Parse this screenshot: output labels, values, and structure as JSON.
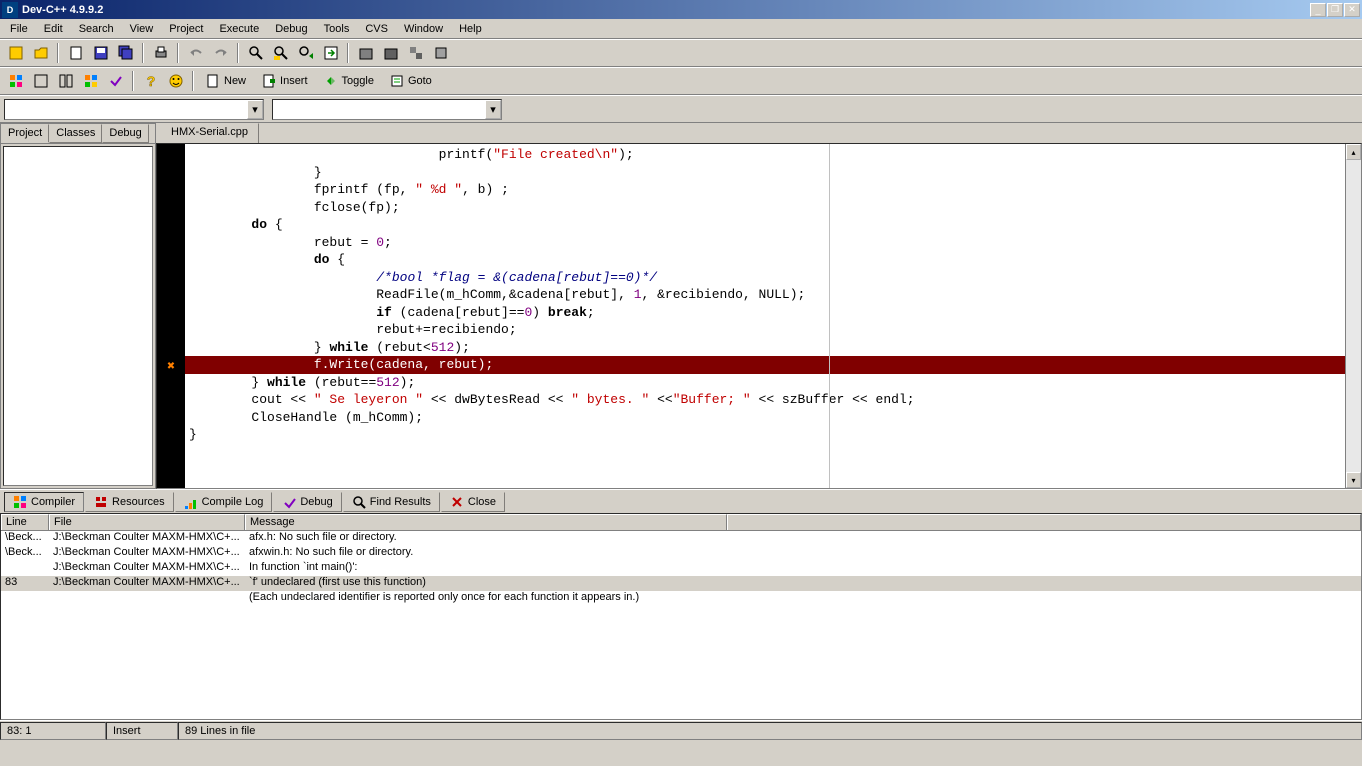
{
  "title": "Dev-C++ 4.9.9.2",
  "menu": [
    "File",
    "Edit",
    "Search",
    "View",
    "Project",
    "Execute",
    "Debug",
    "Tools",
    "CVS",
    "Window",
    "Help"
  ],
  "toolbar2": {
    "new": "New",
    "insert": "Insert",
    "toggle": "Toggle",
    "goto": "Goto"
  },
  "sidebar_tabs": [
    "Project",
    "Classes",
    "Debug"
  ],
  "editor_tab": "HMX-Serial.cpp",
  "code_lines": [
    {
      "indent": 16,
      "parts": [
        {
          "t": "printf(",
          "c": ""
        },
        {
          "t": "\"File created\\n\"",
          "c": "str"
        },
        {
          "t": ");",
          "c": ""
        }
      ]
    },
    {
      "indent": 8,
      "parts": [
        {
          "t": "}",
          "c": ""
        }
      ]
    },
    {
      "indent": 8,
      "parts": [
        {
          "t": "fprintf (fp, ",
          "c": ""
        },
        {
          "t": "\" %d \"",
          "c": "str"
        },
        {
          "t": ", b) ;",
          "c": ""
        }
      ]
    },
    {
      "indent": 8,
      "parts": [
        {
          "t": "fclose(fp);",
          "c": ""
        }
      ]
    },
    {
      "indent": 4,
      "parts": [
        {
          "t": "do",
          "c": "kw"
        },
        {
          "t": " {",
          "c": ""
        }
      ]
    },
    {
      "indent": 8,
      "parts": [
        {
          "t": "rebut = ",
          "c": ""
        },
        {
          "t": "0",
          "c": "num"
        },
        {
          "t": ";",
          "c": ""
        }
      ]
    },
    {
      "indent": 8,
      "parts": [
        {
          "t": "do",
          "c": "kw"
        },
        {
          "t": " {",
          "c": ""
        }
      ]
    },
    {
      "indent": 12,
      "parts": [
        {
          "t": "/*bool *flag = &(cadena[rebut]==0)*/",
          "c": "cmt"
        }
      ]
    },
    {
      "indent": 12,
      "parts": [
        {
          "t": "ReadFile(m_hComm,&cadena[rebut], ",
          "c": ""
        },
        {
          "t": "1",
          "c": "num"
        },
        {
          "t": ", &recibiendo, NULL);",
          "c": ""
        }
      ]
    },
    {
      "indent": 12,
      "parts": [
        {
          "t": "if",
          "c": "kw"
        },
        {
          "t": " (cadena[rebut]==",
          "c": ""
        },
        {
          "t": "0",
          "c": "num"
        },
        {
          "t": ") ",
          "c": ""
        },
        {
          "t": "break",
          "c": "kw"
        },
        {
          "t": ";",
          "c": ""
        }
      ]
    },
    {
      "indent": 12,
      "parts": [
        {
          "t": "rebut+=recibiendo;",
          "c": ""
        }
      ]
    },
    {
      "indent": 8,
      "parts": [
        {
          "t": "} ",
          "c": ""
        },
        {
          "t": "while",
          "c": "kw"
        },
        {
          "t": " (rebut<",
          "c": ""
        },
        {
          "t": "512",
          "c": "num"
        },
        {
          "t": ");",
          "c": ""
        }
      ]
    },
    {
      "indent": 8,
      "hl": true,
      "parts": [
        {
          "t": "f.Write(cadena, rebut);",
          "c": ""
        }
      ]
    },
    {
      "indent": 4,
      "parts": [
        {
          "t": "} ",
          "c": ""
        },
        {
          "t": "while",
          "c": "kw"
        },
        {
          "t": " (rebut==",
          "c": ""
        },
        {
          "t": "512",
          "c": "num"
        },
        {
          "t": ");",
          "c": ""
        }
      ]
    },
    {
      "indent": 4,
      "parts": [
        {
          "t": "cout << ",
          "c": ""
        },
        {
          "t": "\" Se leyeron \"",
          "c": "str"
        },
        {
          "t": " << dwBytesRead << ",
          "c": ""
        },
        {
          "t": "\" bytes. \"",
          "c": "str"
        },
        {
          "t": " <<",
          "c": ""
        },
        {
          "t": "\"Buffer; \"",
          "c": "str"
        },
        {
          "t": " << szBuffer << endl;",
          "c": ""
        }
      ]
    },
    {
      "indent": 4,
      "parts": [
        {
          "t": "CloseHandle (m_hComm);",
          "c": ""
        }
      ]
    },
    {
      "indent": 0,
      "parts": [
        {
          "t": "}",
          "c": ""
        }
      ]
    }
  ],
  "bottom_tabs": [
    "Compiler",
    "Resources",
    "Compile Log",
    "Debug",
    "Find Results",
    "Close"
  ],
  "compiler_headers": [
    "Line",
    "File",
    "Message",
    ""
  ],
  "compiler_rows": [
    {
      "line": "\\Beck...",
      "file": "J:\\Beckman Coulter MAXM-HMX\\C+...",
      "msg": "afx.h: No such file or directory."
    },
    {
      "line": "\\Beck...",
      "file": "J:\\Beckman Coulter MAXM-HMX\\C+...",
      "msg": "afxwin.h: No such file or directory."
    },
    {
      "line": "",
      "file": "J:\\Beckman Coulter MAXM-HMX\\C+...",
      "msg": "In function `int main()':"
    },
    {
      "line": "83",
      "file": "J:\\Beckman Coulter MAXM-HMX\\C+...",
      "msg": "`f' undeclared (first use this function)",
      "sel": true
    },
    {
      "line": "",
      "file": "",
      "msg": "(Each undeclared identifier is reported only once for each function it appears in.)"
    }
  ],
  "status": {
    "pos": "83: 1",
    "mode": "Insert",
    "info": "89 Lines in file"
  }
}
